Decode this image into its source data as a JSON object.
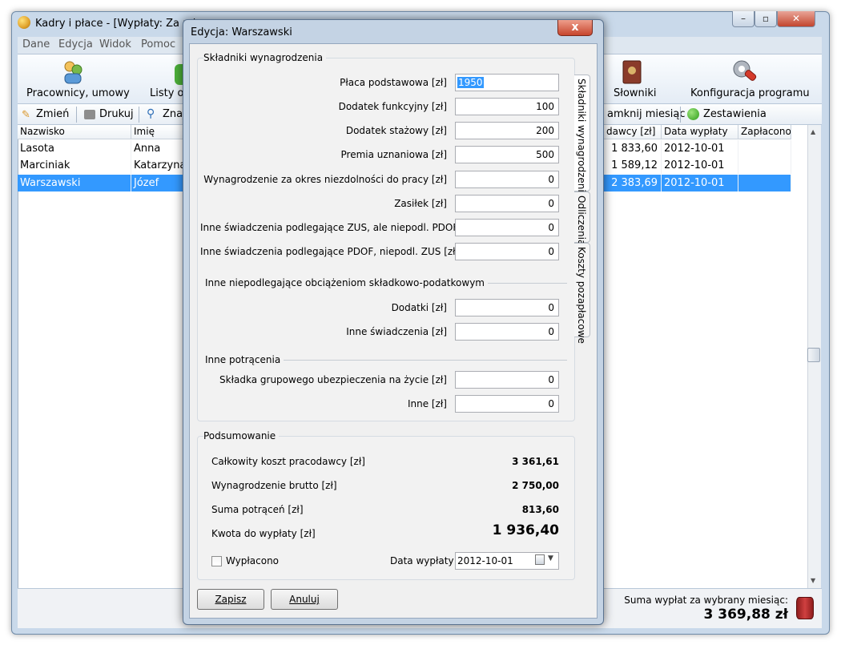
{
  "window": {
    "title": "Kadry i płace - [Wypłaty: Za mie"
  },
  "menu": [
    "Dane",
    "Edycja",
    "Widok",
    "Pomoc"
  ],
  "toolbar": {
    "employees": "Pracownicy, umowy",
    "lists": "Listy ob",
    "dictionaries": "Słowniki",
    "config": "Konfiguracja programu"
  },
  "secbar": {
    "edit": "Zmień",
    "print": "Drukuj",
    "find": "Znaj",
    "close_month": "amknij miesiąc",
    "summaries": "Zestawienia"
  },
  "grid": {
    "headers": [
      "Nazwisko",
      "Imię",
      "dawcy [zł]",
      "Data wypłaty",
      "Zapłacono"
    ],
    "rows": [
      [
        "Lasota",
        "Anna",
        "1 833,60",
        "2012-10-01",
        ""
      ],
      [
        "Marciniak",
        "Katarzyna",
        "1 589,12",
        "2012-10-01",
        ""
      ],
      [
        "Warszawski",
        "Józef",
        "2 383,69",
        "2012-10-01",
        ""
      ]
    ]
  },
  "status": {
    "label": "Suma wypłat za wybrany miesiąc:",
    "value": "3 369,88  zł"
  },
  "dialog": {
    "title": "Edycja: Warszawski",
    "close": "x",
    "section1": "Składniki wynagrodzenia",
    "fields1": [
      {
        "label": "Płaca podstawowa [zł]",
        "value": "1950"
      },
      {
        "label": "Dodatek funkcyjny [zł]",
        "value": "100"
      },
      {
        "label": "Dodatek stażowy [zł]",
        "value": "200"
      },
      {
        "label": "Premia uznaniowa [zł]",
        "value": "500"
      },
      {
        "label": "Wynagrodzenie za okres niezdolności do pracy [zł]",
        "value": "0"
      },
      {
        "label": "Zasiłek [zł]",
        "value": "0"
      },
      {
        "label": "Inne świadczenia podlegające ZUS, ale niepodl. PDOF [zł]",
        "value": "0"
      },
      {
        "label": "Inne świadczenia podlegające PDOF, niepodl. ZUS [zł]",
        "value": "0"
      }
    ],
    "section2": "Inne niepodlegające obciążeniom składkowo-podatkowym",
    "fields2": [
      {
        "label": "Dodatki [zł]",
        "value": "0"
      },
      {
        "label": "Inne świadczenia [zł]",
        "value": "0"
      }
    ],
    "section3": "Inne potrącenia",
    "fields3": [
      {
        "label": "Składka grupowego ubezpieczenia na życie [zł]",
        "value": "0"
      },
      {
        "label": "Inne [zł]",
        "value": "0"
      }
    ],
    "tabs": [
      "Składniki wynagrodzenia",
      "Odliczenia",
      "Koszty pozapłacowe"
    ],
    "summary": {
      "title": "Podsumowanie",
      "items": [
        {
          "label": "Całkowity koszt pracodawcy [zł]",
          "value": "3 361,61"
        },
        {
          "label": "Wynagrodzenie brutto [zł]",
          "value": "2 750,00"
        },
        {
          "label": "Suma potrąceń [zł]",
          "value": "813,60"
        },
        {
          "label": "Kwota do wypłaty [zł]",
          "value": "1 936,40"
        }
      ],
      "paid_label": "Wypłacono",
      "date_label": "Data wypłaty",
      "date_value": "2012-10-01"
    },
    "buttons": {
      "save": "Zapisz",
      "cancel": "Anuluj"
    }
  }
}
